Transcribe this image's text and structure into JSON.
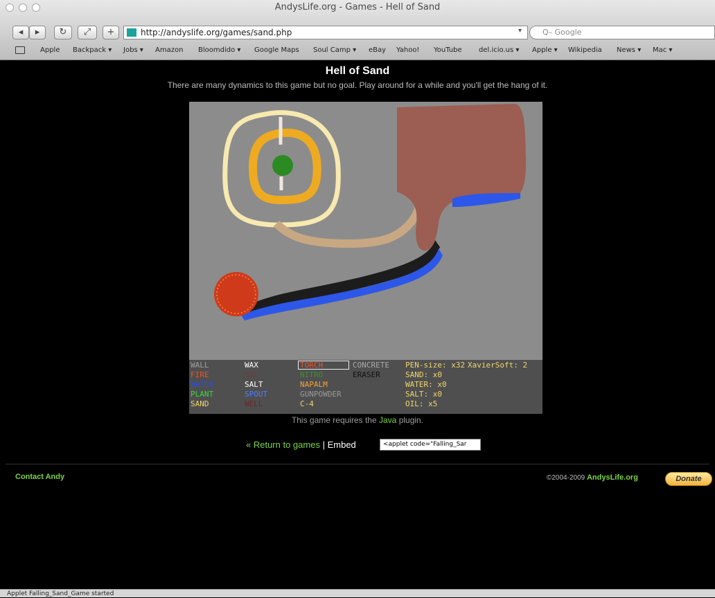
{
  "window": {
    "title": "AndysLife.org - Games - Hell of Sand"
  },
  "toolbar": {
    "url": "http://andyslife.org/games/sand.php",
    "search_placeholder": "Q– Google",
    "back_icon": "back-arrow-icon",
    "forward_icon": "forward-arrow-icon",
    "reload_icon": "reload-icon",
    "add_icon": "plus-icon"
  },
  "bookmarks": [
    "Apple",
    "Backpack ▾",
    "Jobs ▾",
    "Amazon",
    "Bloomdido ▾",
    "Google Maps",
    "Soul Camp ▾",
    "eBay",
    "Yahoo!",
    "YouTube",
    "del.icio.us ▾",
    "Apple ▾",
    "Wikipedia",
    "News ▾",
    "Mac ▾"
  ],
  "page": {
    "title": "Hell of Sand",
    "subtitle": "There are many dynamics to this game but no goal. Play around for a while and you'll get the hang of it."
  },
  "game": {
    "elements": [
      {
        "label": "WALL",
        "color": "#9e9e9e"
      },
      {
        "label": "WAX",
        "color": "#ffffff"
      },
      {
        "label": "TORCH",
        "color": "#e8532b"
      },
      {
        "label": "CONCRETE",
        "color": "#a9a9a9"
      },
      {
        "label": "FIRE",
        "color": "#e8532b"
      },
      {
        "label": "OIL",
        "color": "#6e3b3b"
      },
      {
        "label": "NITRO",
        "color": "#3d8f2a"
      },
      {
        "label": "ERASER",
        "color": "#111111"
      },
      {
        "label": "WATER",
        "color": "#2a4be8"
      },
      {
        "label": "SALT",
        "color": "#ffffff"
      },
      {
        "label": "NAPALM",
        "color": "#f2a33a"
      },
      {
        "label": "PLANT",
        "color": "#3fd63f"
      },
      {
        "label": "SPOUT",
        "color": "#4f7cff"
      },
      {
        "label": "GUNPOWDER",
        "color": "#9a9a9a"
      },
      {
        "label": "SAND",
        "color": "#f0d66c"
      },
      {
        "label": "WELL",
        "color": "#6a2626"
      },
      {
        "label": "C-4",
        "color": "#f0d66c"
      }
    ],
    "selected": "TORCH",
    "stats": {
      "pen": "PEN-size: x32",
      "xavier": "XavierSoft: 2",
      "sand": "SAND: x0",
      "water": "WATER: x0",
      "salt": "SALT: x0",
      "oil": "OIL: x5"
    }
  },
  "requires": {
    "prefix": "This game requires the",
    "link": "Java",
    "suffix": "plugin."
  },
  "links": {
    "return": "« Return to games",
    "separator": "|",
    "embed": "Embed",
    "embed_code": "<applet code=\"Falling_Sar"
  },
  "footer": {
    "contact": "Contact Andy",
    "copyright": "©2004-2009",
    "site": "AndysLife.org",
    "donate": "Donate"
  },
  "status": "Applet Falling_Sand_Game started"
}
